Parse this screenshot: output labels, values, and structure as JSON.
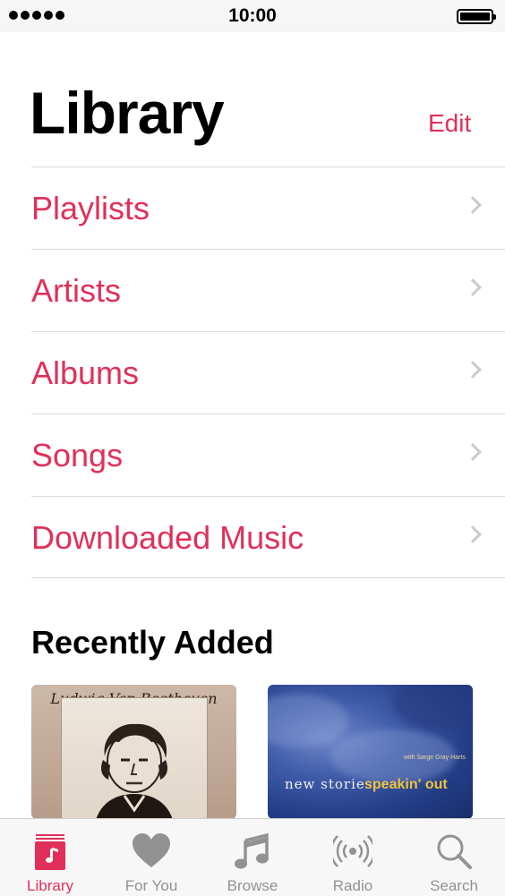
{
  "status_bar": {
    "time": "10:00"
  },
  "header": {
    "title": "Library",
    "edit_label": "Edit"
  },
  "menu": {
    "items": [
      {
        "label": "Playlists"
      },
      {
        "label": "Artists"
      },
      {
        "label": "Albums"
      },
      {
        "label": "Songs"
      },
      {
        "label": "Downloaded Music"
      }
    ]
  },
  "recently_added": {
    "title": "Recently Added",
    "albums": [
      {
        "art_text": "Ludwig Van Beethoven"
      },
      {
        "art_text": "new stories",
        "art_subtitle": "speakin' out",
        "art_credit": "with Sarge Gray Harts"
      }
    ]
  },
  "tab_bar": {
    "tabs": [
      {
        "label": "Library",
        "icon": "music-note-square-icon",
        "active": true
      },
      {
        "label": "For You",
        "icon": "heart-icon",
        "active": false
      },
      {
        "label": "Browse",
        "icon": "music-note-icon",
        "active": false
      },
      {
        "label": "Radio",
        "icon": "radio-broadcast-icon",
        "active": false
      },
      {
        "label": "Search",
        "icon": "search-icon",
        "active": false
      }
    ]
  },
  "colors": {
    "accent": "#e0305a",
    "tab_inactive": "#929292"
  }
}
